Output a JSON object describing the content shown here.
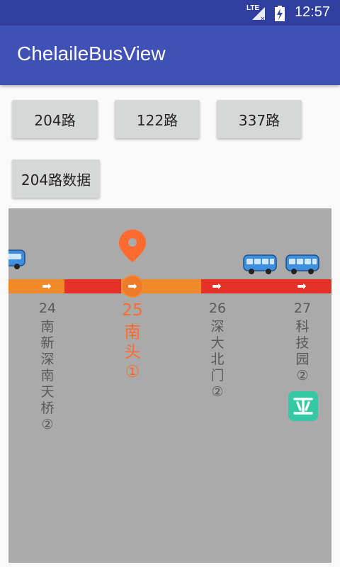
{
  "status_bar": {
    "time": "12:57",
    "network_label": "LTE",
    "icons": [
      "signal-icon",
      "battery-charging-icon"
    ]
  },
  "app_bar": {
    "title": "ChelaileBusView"
  },
  "buttons": [
    {
      "label": "204路"
    },
    {
      "label": "122路"
    },
    {
      "label": "337路"
    },
    {
      "label": "204路数据"
    }
  ],
  "bus_view": {
    "colors": {
      "background": "#aaaaaa",
      "congested": "#e53228",
      "normal": "#f08a28",
      "current": "#ff6a2e",
      "metro": "#34c8a4",
      "bus": "#3f8fe0"
    },
    "stations": [
      {
        "number": "24",
        "name": [
          "南",
          "新",
          "深",
          "南",
          "天",
          "桥",
          "②"
        ],
        "current": false
      },
      {
        "number": "25",
        "name": [
          "南",
          "头",
          "①"
        ],
        "current": true
      },
      {
        "number": "26",
        "name": [
          "深",
          "大",
          "北",
          "门",
          "②"
        ],
        "current": false
      },
      {
        "number": "27",
        "name": [
          "科",
          "技",
          "园",
          "②"
        ],
        "current": false,
        "metro": true
      }
    ],
    "icons": [
      "location-pin-icon",
      "bus-icon",
      "metro-icon",
      "arrow-right-icon"
    ]
  }
}
